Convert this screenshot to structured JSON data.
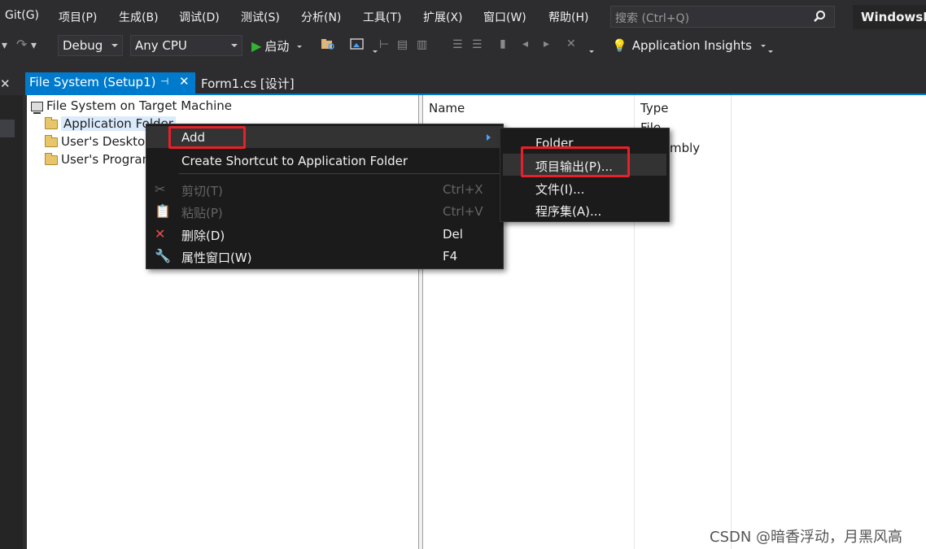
{
  "menubar": {
    "items": [
      "Git(G)",
      "项目(P)",
      "生成(B)",
      "调试(D)",
      "测试(S)",
      "分析(N)",
      "工具(T)",
      "扩展(X)",
      "窗口(W)",
      "帮助(H)"
    ],
    "search_placeholder": "搜索 (Ctrl+Q)",
    "solution_name": "WindowsF"
  },
  "toolbar": {
    "configuration": "Debug",
    "platform": "Any CPU",
    "start_label": "启动",
    "app_insights_label": "Application Insights"
  },
  "tabs": {
    "active_label": "File System (Setup1)",
    "second_label": "Form1.cs [设计]"
  },
  "tree": {
    "root": "File System on Target Machine",
    "items": [
      "Application Folder",
      "User's Desktop",
      "User's Program"
    ]
  },
  "list": {
    "col_name": "Name",
    "col_type": "Type",
    "type_cells": [
      "File",
      "mbly"
    ]
  },
  "context_menu": {
    "items": [
      {
        "label": "Add",
        "shortcut": ""
      },
      {
        "label": "Create Shortcut to Application Folder",
        "shortcut": ""
      },
      {
        "label": "剪切(T)",
        "shortcut": "Ctrl+X"
      },
      {
        "label": "粘贴(P)",
        "shortcut": "Ctrl+V"
      },
      {
        "label": "删除(D)",
        "shortcut": "Del"
      },
      {
        "label": "属性窗口(W)",
        "shortcut": "F4"
      }
    ]
  },
  "submenu": {
    "items": [
      "Folder",
      "项目输出(P)...",
      "文件(I)...",
      "程序集(A)..."
    ]
  },
  "watermark": "CSDN @暗香浮动，月黑风高",
  "colors": {
    "accent": "#007acc",
    "highlight_box": "#e8202a",
    "start_green": "#32b432"
  }
}
